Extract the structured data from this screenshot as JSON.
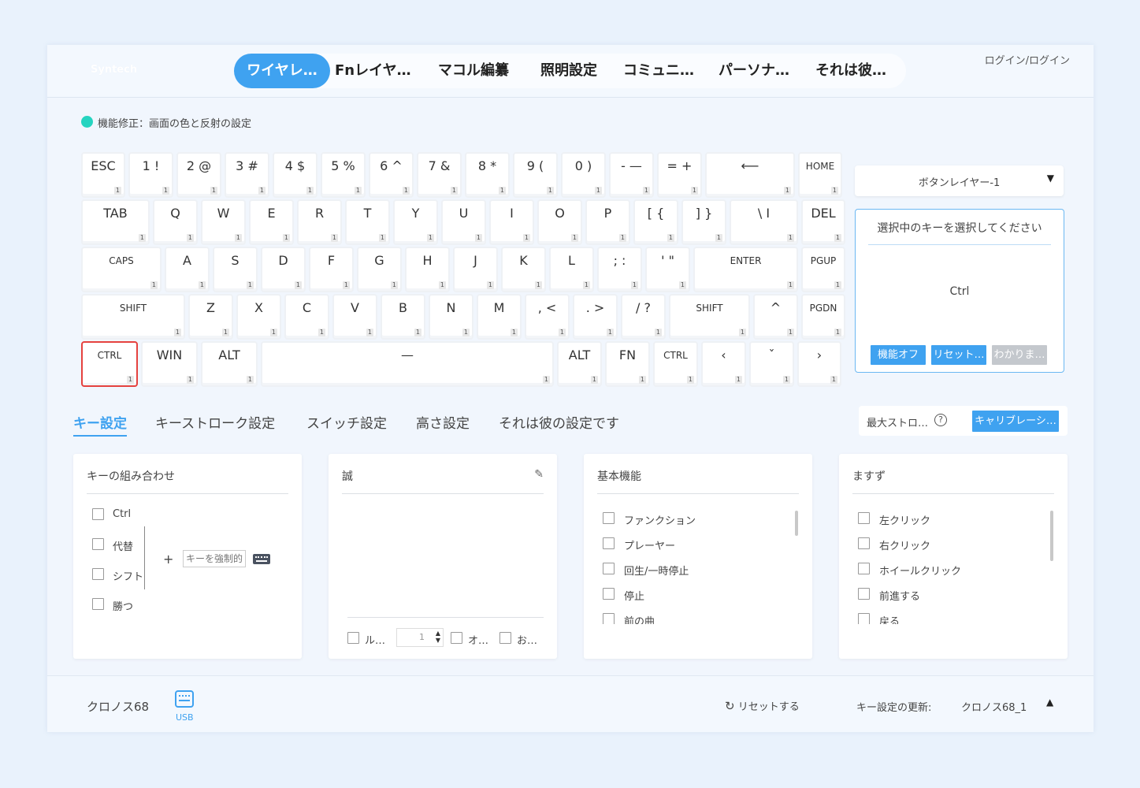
{
  "header": {
    "brand": "Syntech",
    "tabs": [
      "ワイヤレ…",
      "Fnレイヤ…",
      "マコル編纂",
      "照明設定",
      "コミュニ…",
      "パーソナ…",
      "それは彼…"
    ],
    "active_tab": 0,
    "login": "ログイン/ログイン"
  },
  "status": {
    "text": "機能修正：画面の色と反射の設定",
    "dot_color": "#25d4c0"
  },
  "keyboard": {
    "layer_badge": "1",
    "rows": [
      [
        "ESC",
        "1 !",
        "2 @",
        "3 #",
        "4 $",
        "5 %",
        "6 ^",
        "7 &",
        "8 *",
        "9 (",
        "0 )",
        "- —",
        "= +",
        "⟵",
        "HOME"
      ],
      [
        "TAB",
        "Q",
        "W",
        "E",
        "R",
        "T",
        "Y",
        "U",
        "I",
        "O",
        "P",
        "[ {",
        "] }",
        "\\ I",
        "DEL"
      ],
      [
        "CAPS",
        "A",
        "S",
        "D",
        "F",
        "G",
        "H",
        "J",
        "K",
        "L",
        "; :",
        "' \"",
        "ENTER",
        "PGUP"
      ],
      [
        "SHIFT",
        "Z",
        "X",
        "C",
        "V",
        "B",
        "N",
        "M",
        ", <",
        ". >",
        "/ ?",
        "SHIFT",
        "^",
        "PGDN"
      ],
      [
        "CTRL",
        "WIN",
        "ALT",
        "—",
        "ALT",
        "FN",
        "CTRL",
        "‹",
        "ˇ",
        "›"
      ]
    ],
    "selected_key": "CTRL"
  },
  "layer_select": {
    "value": "ボタンレイヤー-1",
    "icon": "caret-down-icon"
  },
  "key_info": {
    "heading": "選択中のキーを選択してください",
    "current": "Ctrl",
    "buttons": [
      "機能オフ",
      "リセット…",
      "わかりま…"
    ]
  },
  "settings_tabs": [
    "キー設定",
    "キーストローク設定",
    "スイッチ設定",
    "高さ設定",
    "それは彼の設定です"
  ],
  "stroke": {
    "label": "最大ストロ…",
    "help": "?",
    "calibrate": "キャリブレーシ…"
  },
  "panels": {
    "combo": {
      "title": "キーの組み合わせ",
      "mods": [
        "Ctrl",
        "代替",
        "シフト",
        "勝つ"
      ],
      "plus": "+",
      "placeholder": "キーを強制的"
    },
    "macro": {
      "title": "誠",
      "loop": "ル…",
      "count": "1",
      "opt2": "オ…",
      "opt3": "お…"
    },
    "basic": {
      "title": "基本機能",
      "items": [
        "ファンクション",
        "プレーヤー",
        "回生/一時停止",
        "停止",
        "前の曲"
      ]
    },
    "mouse": {
      "title": "ますず",
      "items": [
        "左クリック",
        "右クリック",
        "ホイールクリック",
        "前進する",
        "戻る"
      ]
    }
  },
  "footer": {
    "device": "クロノス68",
    "conn": "USB",
    "reset": "リセットする",
    "update_label": "キー設定の更新:",
    "profile": "クロノス68_1"
  },
  "colors": {
    "accent": "#3fa2f0",
    "background": "#e9f2fc",
    "selected_border": "#e5423f"
  }
}
